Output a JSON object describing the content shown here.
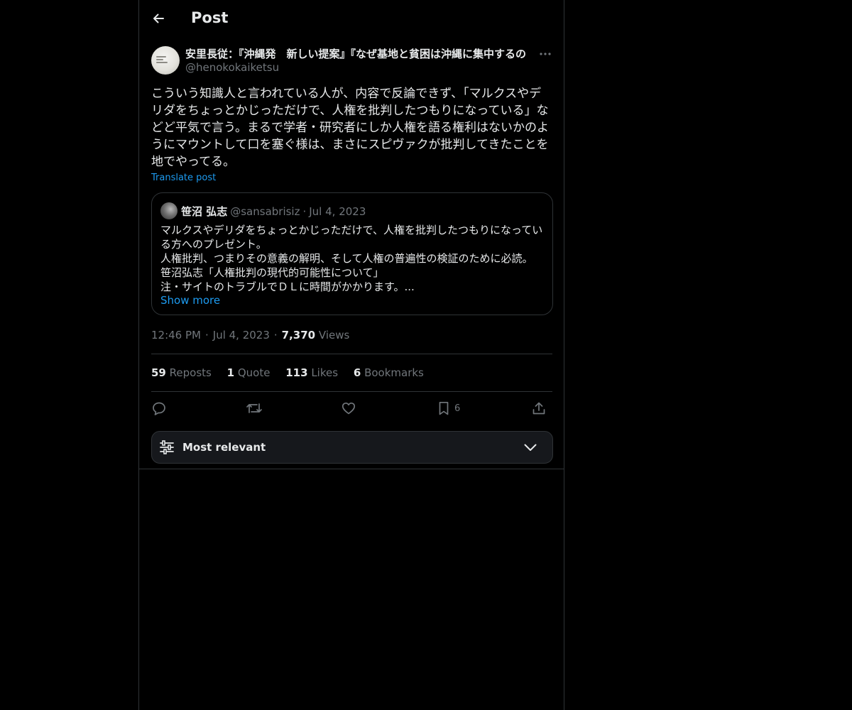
{
  "header": {
    "title": "Post"
  },
  "post": {
    "author_name": "安里長従：『沖縄発　新しい提案』『なぜ基地と貧困は沖縄に集中するの",
    "author_handle": "@henokokaiketsu",
    "text": "こういう知識人と言われている人が、内容で反論できず、「マルクスやデリダをちょっとかじっただけで、人権を批判したつもりになっている」などど平気で言う。まるで学者・研究者にしか人権を語る権利はないかのようにマウントして口を塞ぐ様は、まさにスピヴァクが批判してきたことを地でやってる。",
    "translate_label": "Translate post",
    "time": "12:46 PM",
    "date": "Jul 4, 2023",
    "views_count": "7,370",
    "views_label": "Views"
  },
  "quote": {
    "name": "笹沼 弘志",
    "handle": "@sansabrisiz",
    "separator": "·",
    "date": "Jul 4, 2023",
    "lines": [
      "マルクスやデリダをちょっとかじっただけで、人権を批判したつもりになってい",
      "る方へのプレゼント。",
      "人権批判、つまりその意義の解明、そして人権の普遍性の検証のために必読。",
      "笹沼弘志「人権批判の現代的可能性について」",
      "注・サイトのトラブルでＤＬに時間がかかります。..."
    ],
    "show_more": "Show more"
  },
  "meta": {
    "separator": "·"
  },
  "stats": {
    "reposts_count": "59",
    "reposts_label": "Reposts",
    "quotes_count": "1",
    "quotes_label": "Quote",
    "likes_count": "113",
    "likes_label": "Likes",
    "bookmarks_count": "6",
    "bookmarks_label": "Bookmarks"
  },
  "actions": {
    "reply_icon": "reply-icon",
    "repost_icon": "repost-icon",
    "like_icon": "heart-icon",
    "bookmark_icon": "bookmark-icon",
    "bookmark_count": "6",
    "share_icon": "share-icon"
  },
  "sort": {
    "label": "Most relevant"
  },
  "colors": {
    "background": "#000000",
    "text": "#e7e9ea",
    "secondary": "#71767b",
    "accent": "#1d9bf0",
    "border": "#2f3336"
  }
}
